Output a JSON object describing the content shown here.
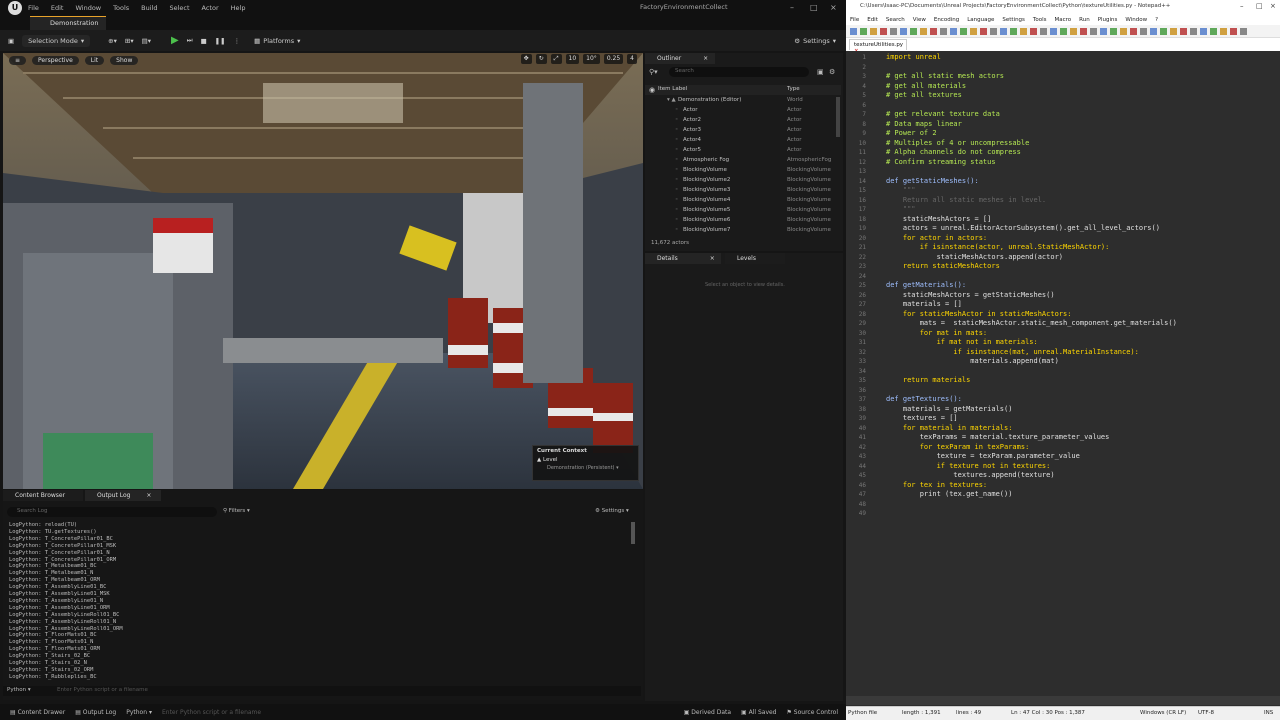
{
  "ue": {
    "menu": [
      "File",
      "Edit",
      "Window",
      "Tools",
      "Build",
      "Select",
      "Actor",
      "Help"
    ],
    "window_title": "FactoryEnvironmentCollect",
    "tab": "Demonstration",
    "toolbar": {
      "mode": "Selection Mode",
      "platforms": "Platforms",
      "settings": "Settings"
    },
    "viewport": {
      "perspective": "Perspective",
      "lit": "Lit",
      "show": "Show",
      "icons": [
        "10",
        "10°",
        "0.25",
        "4"
      ]
    },
    "context": {
      "title": "Current Context",
      "level": "Level",
      "persistent": "Demonstration (Persistent)"
    },
    "outliner": {
      "tab": "Outliner",
      "search_placeholder": "Search",
      "col_label": "Item Label",
      "col_type": "Type",
      "rows": [
        {
          "label": "Demonstration (Editor)",
          "type": "World"
        },
        {
          "label": "Actor",
          "type": "Actor"
        },
        {
          "label": "Actor2",
          "type": "Actor"
        },
        {
          "label": "Actor3",
          "type": "Actor"
        },
        {
          "label": "Actor4",
          "type": "Actor"
        },
        {
          "label": "Actor5",
          "type": "Actor"
        },
        {
          "label": "Atmospheric Fog",
          "type": "AtmosphericFog"
        },
        {
          "label": "BlockingVolume",
          "type": "BlockingVolume"
        },
        {
          "label": "BlockingVolume2",
          "type": "BlockingVolume"
        },
        {
          "label": "BlockingVolume3",
          "type": "BlockingVolume"
        },
        {
          "label": "BlockingVolume4",
          "type": "BlockingVolume"
        },
        {
          "label": "BlockingVolume5",
          "type": "BlockingVolume"
        },
        {
          "label": "BlockingVolume6",
          "type": "BlockingVolume"
        },
        {
          "label": "BlockingVolume7",
          "type": "BlockingVolume"
        }
      ],
      "count": "11,672 actors"
    },
    "details": {
      "tab": "Details",
      "levels_tab": "Levels",
      "empty": "Select an object to view details."
    },
    "bottom": {
      "tab_cb": "Content Browser",
      "tab_log": "Output Log",
      "search_placeholder": "Search Log",
      "filters": "Filters",
      "settings": "Settings",
      "log": [
        "LogPython: reload(TU)",
        "LogPython: TU.getTextures()",
        "LogPython: T_ConcretePillar01_BC",
        "LogPython: T_ConcretePillar01_MSK",
        "LogPython: T_ConcretePillar01_N",
        "LogPython: T_ConcretePillar01_ORM",
        "LogPython: T_Metalbeam01_BC",
        "LogPython: T_Metalbeam01_N",
        "LogPython: T_Metalbeam01_ORM",
        "LogPython: T_AssemblyLine01_BC",
        "LogPython: T_AssemblyLine01_MSK",
        "LogPython: T_AssemblyLine01_N",
        "LogPython: T_AssemblyLine01_ORM",
        "LogPython: T_AssemblyLineRoll01_BC",
        "LogPython: T_AssemblyLineRoll01_N",
        "LogPython: T_AssemblyLineRoll01_ORM",
        "LogPython: T_FloorMats01_BC",
        "LogPython: T_FloorMats01_N",
        "LogPython: T_FloorMats01_ORM",
        "LogPython: T_Stairs_02_BC",
        "LogPython: T_Stairs_02_N",
        "LogPython: T_Stairs_02_ORM",
        "LogPython: T_Rubbleplies_BC"
      ],
      "python": "Python",
      "python_placeholder": "Enter Python script or a filename"
    },
    "status": {
      "content_drawer": "Content Drawer",
      "output_log": "Output Log",
      "python": "Python",
      "placeholder": "Enter Python script or a filename",
      "derived": "Derived Data",
      "saved": "All Saved",
      "source": "Source Control"
    }
  },
  "np": {
    "title": "C:\\Users\\Isaac-PC\\Documents\\Unreal Projects\\FactoryEnvironmentCollect\\Python\\textureUtilities.py - Notepad++",
    "menu": [
      "File",
      "Edit",
      "Search",
      "View",
      "Encoding",
      "Language",
      "Settings",
      "Tools",
      "Macro",
      "Run",
      "Plugins",
      "Window",
      "?"
    ],
    "tab": "textureUtilities.py",
    "lines": [
      "import unreal",
      "",
      "# get all static mesh actors",
      "# get all materials",
      "# get all textures",
      "",
      "# get relevant texture data",
      "# Data maps linear",
      "# Power of 2",
      "# Multiples of 4 or uncompressable",
      "# Alpha channels do not compress",
      "# Confirm streaming status",
      "",
      "def getStaticMeshes():",
      "    \"\"\"",
      "    Return all static meshes in level.",
      "    \"\"\"",
      "    staticMeshActors = []",
      "    actors = unreal.EditorActorSubsystem().get_all_level_actors()",
      "    for actor in actors:",
      "        if isinstance(actor, unreal.StaticMeshActor):",
      "            staticMeshActors.append(actor)",
      "    return staticMeshActors",
      "",
      "def getMaterials():",
      "    staticMeshActors = getStaticMeshes()",
      "    materials = []",
      "    for staticMeshActor in staticMeshActors:",
      "        mats =  staticMeshActor.static_mesh_component.get_materials()",
      "        for mat in mats:",
      "            if mat not in materials:",
      "                if isinstance(mat, unreal.MaterialInstance):",
      "                    materials.append(mat)",
      "",
      "    return materials",
      "",
      "def getTextures():",
      "    materials = getMaterials()",
      "    textures = []",
      "    for material in materials:",
      "        texParams = material.texture_parameter_values",
      "        for texParam in texParams:",
      "            texture = texParam.parameter_value",
      "            if texture not in textures:",
      "                textures.append(texture)",
      "    for tex in textures:",
      "        print (tex.get_name())",
      "",
      ""
    ],
    "status": {
      "type": "Python file",
      "length": "length : 1,391",
      "lines": "lines : 49",
      "pos": "Ln : 47    Col : 30    Pos : 1,387",
      "eol": "Windows (CR LF)",
      "enc": "UTF-8",
      "ins": "INS"
    }
  }
}
